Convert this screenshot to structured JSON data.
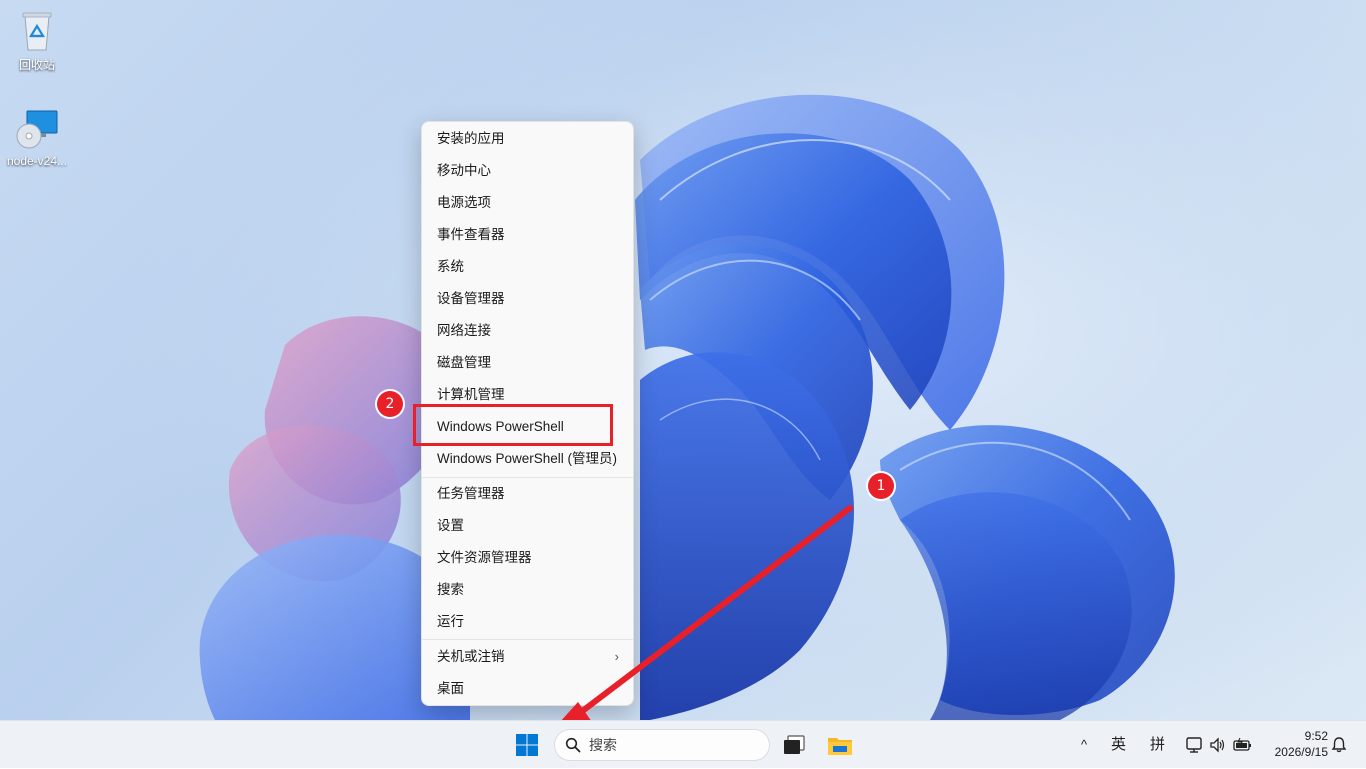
{
  "desktop": {
    "icons": [
      {
        "label": "回收站",
        "icon": "recycle-bin-icon"
      },
      {
        "label": "node-v24...",
        "icon": "installer-disc-icon"
      }
    ]
  },
  "context_menu": {
    "groups": [
      [
        "安装的应用",
        "移动中心",
        "电源选项",
        "事件查看器",
        "系统",
        "设备管理器",
        "网络连接",
        "磁盘管理",
        "计算机管理",
        "Windows PowerShell",
        "Windows PowerShell (管理员)"
      ],
      [
        "任务管理器",
        "设置",
        "文件资源管理器",
        "搜索",
        "运行"
      ],
      [
        "关机或注销",
        "桌面"
      ]
    ],
    "submenu_arrow": "›",
    "highlighted_item": "Windows PowerShell"
  },
  "annotations": {
    "step1": "1",
    "step2": "2",
    "color": "#e8202a"
  },
  "taskbar": {
    "search_placeholder": "搜索",
    "tray": {
      "chevron": "^",
      "lang_indicator": "英",
      "ime_mode": "拼",
      "time": "9:52",
      "date": "2026/9/15"
    },
    "accent": "#0078d4"
  }
}
